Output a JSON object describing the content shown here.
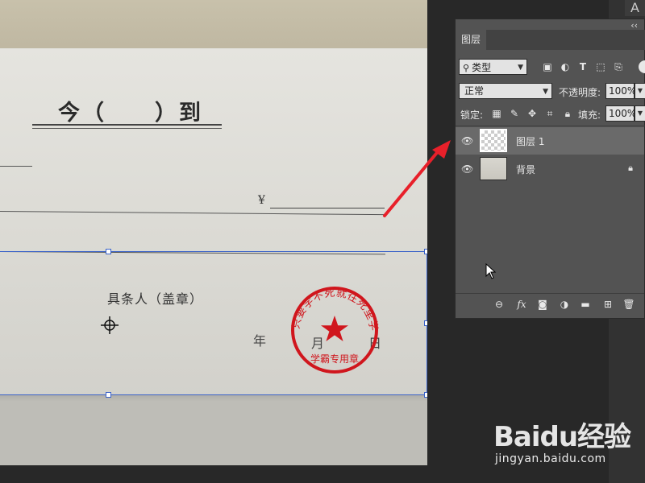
{
  "document": {
    "title": "今（　　）到",
    "currency_symbol": "¥",
    "signer_label": "具条人（盖章）",
    "date_year": "年",
    "date_month": "月",
    "date_day": "日",
    "stamp": {
      "ring_text": "只要学不死就往死里学",
      "center_text": "学霸专用章",
      "center_glyph": "star-icon",
      "color": "#d0161d"
    }
  },
  "layers_panel": {
    "collapse_glyph": "‹‹",
    "tab_label": "图层",
    "filter_label": "类型",
    "blend_mode": "正常",
    "opacity_label": "不透明度:",
    "opacity_value": "100%",
    "lock_label": "锁定:",
    "fill_label": "填充:",
    "fill_value": "100%",
    "layers": [
      {
        "name": "图层 1",
        "selected": true,
        "visible": true,
        "locked": false
      },
      {
        "name": "背景",
        "selected": false,
        "visible": true,
        "locked": true
      }
    ],
    "footer_icons": [
      "link-icon",
      "fx-icon",
      "mask-icon",
      "adjustment-icon",
      "folder-icon",
      "new-layer-icon",
      "trash-icon"
    ]
  },
  "app": {
    "corner_glyph": "A"
  },
  "watermark": {
    "logo_text": "Baidu经验",
    "url": "jingyan.baidu.com"
  },
  "colors": {
    "annotation_arrow": "#e8202a",
    "selection": "#3a62c8",
    "panel_bg": "#535353",
    "selected_layer": "#6a6a6a"
  }
}
